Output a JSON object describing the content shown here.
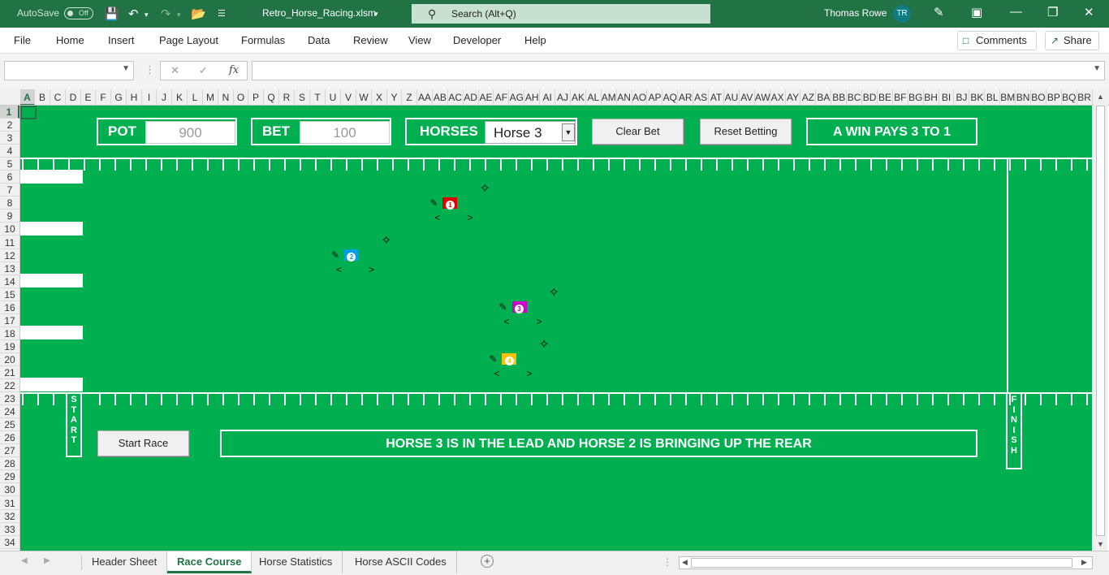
{
  "titlebar": {
    "autosave_label": "AutoSave",
    "autosave_state": "Off",
    "filename": "Retro_Horse_Racing.xlsm",
    "search_placeholder": "Search (Alt+Q)",
    "user_name": "Thomas Rowe",
    "user_initials": "TR"
  },
  "ribbon": {
    "menus": [
      "File",
      "Home",
      "Insert",
      "Page Layout",
      "Formulas",
      "Data",
      "Review",
      "View",
      "Developer",
      "Help"
    ],
    "comments_label": "Comments",
    "share_label": "Share"
  },
  "formula_bar": {
    "name_box": "",
    "fx_label": "fx",
    "formula": ""
  },
  "grid": {
    "columns": [
      "A",
      "B",
      "C",
      "D",
      "E",
      "F",
      "G",
      "H",
      "I",
      "J",
      "K",
      "L",
      "M",
      "N",
      "O",
      "P",
      "Q",
      "R",
      "S",
      "T",
      "U",
      "V",
      "W",
      "X",
      "Y",
      "Z",
      "AA",
      "AB",
      "AC",
      "AD",
      "AE",
      "AF",
      "AG",
      "AH",
      "AI",
      "AJ",
      "AK",
      "AL",
      "AM",
      "AN",
      "AO",
      "AP",
      "AQ",
      "AR",
      "AS",
      "AT",
      "AU",
      "AV",
      "AW",
      "AX",
      "AY",
      "AZ",
      "BA",
      "BB",
      "BC",
      "BD",
      "BE",
      "BF",
      "BG",
      "BH",
      "BI",
      "BJ",
      "BK",
      "BL",
      "BM",
      "BN",
      "BO",
      "BP",
      "BQ",
      "BR"
    ],
    "rows": [
      "1",
      "2",
      "3",
      "4",
      "5",
      "6",
      "7",
      "8",
      "9",
      "10",
      "11",
      "12",
      "13",
      "14",
      "15",
      "16",
      "17",
      "18",
      "19",
      "20",
      "21",
      "22",
      "23",
      "24",
      "25",
      "26",
      "27",
      "28",
      "29",
      "30",
      "31",
      "32",
      "33",
      "34"
    ],
    "selected_cell": "A1"
  },
  "race": {
    "pot_label": "POT",
    "pot_value": "900",
    "bet_label": "BET",
    "bet_value": "100",
    "horses_label": "HORSES",
    "horse_selected": "Horse 3",
    "clear_bet_label": "Clear Bet",
    "reset_betting_label": "Reset Betting",
    "odds_text": "A WIN PAYS 3 TO 1",
    "start_race_label": "Start Race",
    "status_message": "HORSE 3 IS IN THE LEAD AND HORSE 2 IS BRINGING UP THE REAR",
    "start_letters": [
      "S",
      "T",
      "A",
      "R",
      "T"
    ],
    "finish_letters": [
      "F",
      "I",
      "N",
      "I",
      "S",
      "H"
    ],
    "horses": [
      {
        "number": "1",
        "color": "#e00000",
        "progress_pct": 43
      },
      {
        "number": "2",
        "color": "#00a0e6",
        "progress_pct": 33
      },
      {
        "number": "3",
        "color": "#cc00cc",
        "progress_pct": 50
      },
      {
        "number": "4",
        "color": "#ffc000",
        "progress_pct": 49
      }
    ]
  },
  "sheets": {
    "tabs": [
      "Header Sheet",
      "Race Course",
      "Horse Statistics",
      "Horse ASCII Codes"
    ],
    "active": "Race Course"
  }
}
